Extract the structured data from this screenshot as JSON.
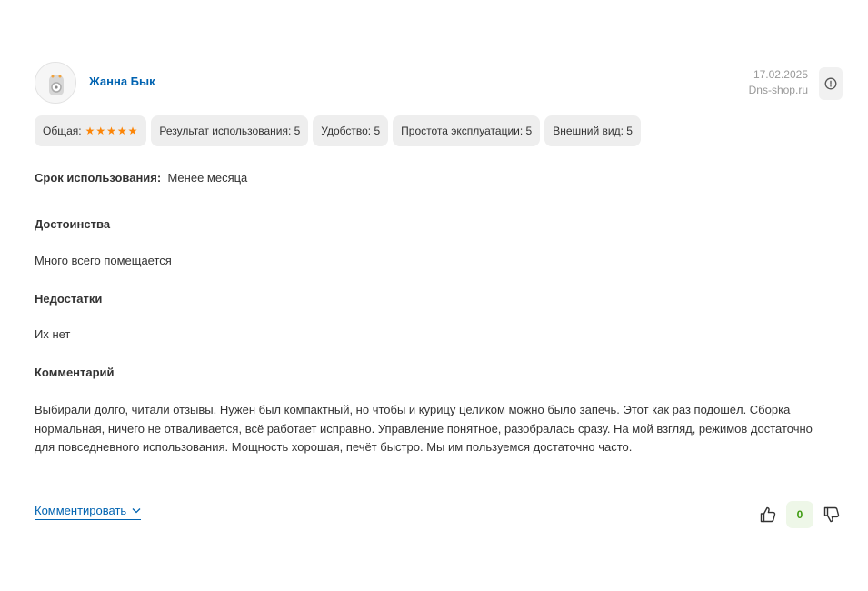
{
  "author": {
    "name": "Жанна Бык",
    "avatar_icon": "user-avatar-icon"
  },
  "meta": {
    "date": "17.02.2025",
    "source": "Dns-shop.ru",
    "info_icon": "info-icon"
  },
  "ratings": [
    {
      "label": "Общая:",
      "stars": "★★★★★",
      "value": 5
    },
    {
      "label": "Результат использования: 5"
    },
    {
      "label": "Удобство: 5"
    },
    {
      "label": "Простота эксплуатации: 5"
    },
    {
      "label": "Внешний вид: 5"
    }
  ],
  "usage": {
    "label": "Срок использования:",
    "value": "Менее месяца"
  },
  "pros": {
    "title": "Достоинства",
    "text": "Много всего помещается"
  },
  "cons": {
    "title": "Недостатки",
    "text": "Их нет"
  },
  "comment": {
    "title": "Комментарий",
    "text": "Выбирали долго, читали отзывы. Нужен был компактный, но чтобы и курицу целиком можно было запечь. Этот как раз подошёл. Сборка нормальная, ничего не отваливается, всё работает исправно. Управление понятное, разобралась сразу. На мой взгляд, режимов достаточно для повседневного использования. Мощность хорошая, печёт быстро. Мы им пользуемся достаточно часто."
  },
  "actions": {
    "comment_link": "Комментировать",
    "vote_count": "0"
  },
  "colors": {
    "link": "#0063b1",
    "star": "#fc8507",
    "chip_bg": "#eeeeee",
    "vote_positive": "#3e9b10"
  }
}
